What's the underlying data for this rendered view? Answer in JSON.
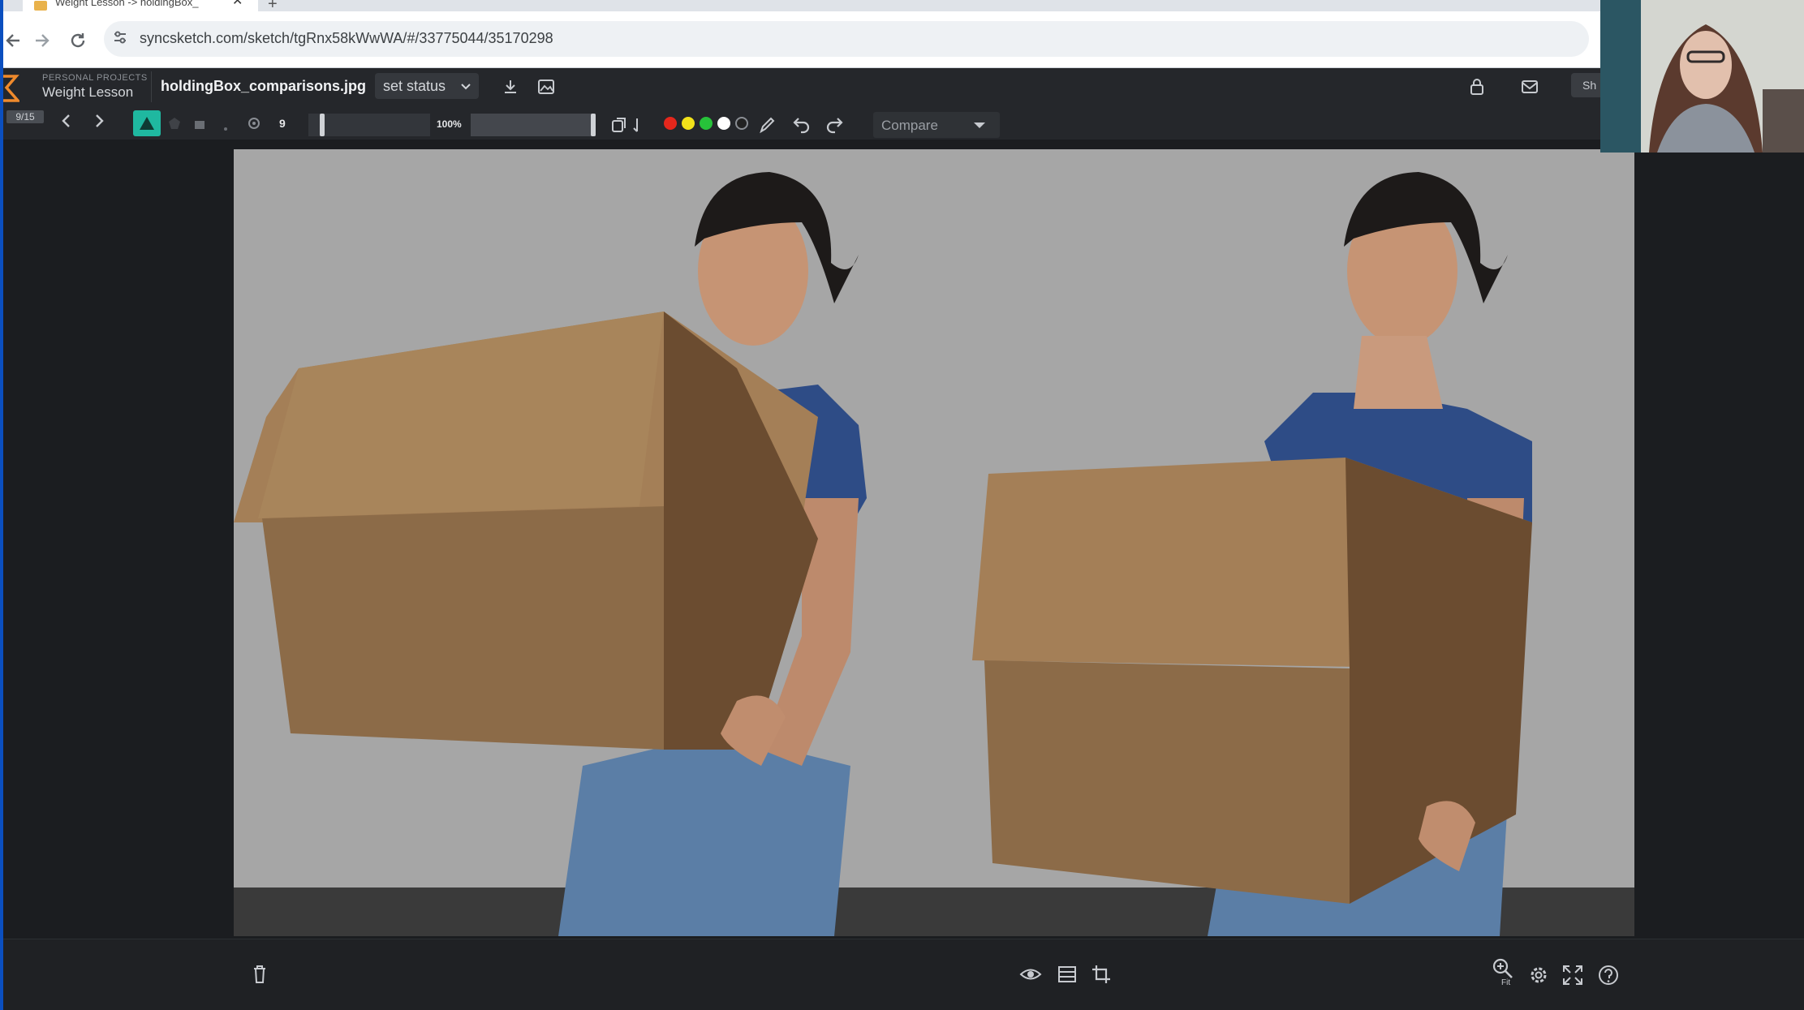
{
  "browser": {
    "tab_title": "Weight Lesson -> holdingBox_",
    "new_tab_label": "+",
    "tab_close": "✕",
    "url": "syncsketch.com/sketch/tgRnx58kWwWA/#/33775044/35170298"
  },
  "app": {
    "project_category": "PERSONAL PROJECTS",
    "project_name": "Weight Lesson",
    "file_name": "holdingBox_comparisons.jpg",
    "status_label": "set status",
    "share_label": "Sh",
    "page_count": "9/15",
    "brush_size": "9",
    "opacity_label": "100%",
    "compare_label": "Compare",
    "brush_size_value": 0.1,
    "opacity_value": 1.0
  },
  "colors": {
    "accent": "#1fb8a0",
    "swatches": [
      "#e5271c",
      "#f2e21a",
      "#27c23a",
      "#ffffff",
      "#222222"
    ]
  },
  "icons": {
    "toolbar": [
      "back-icon",
      "forward-icon",
      "pen-icon",
      "shape-icon",
      "eraser-icon",
      "select-icon",
      "gear-icon",
      "copy-icon",
      "eyedropper-icon",
      "undo-icon",
      "redo-icon"
    ],
    "bottom": [
      "trash-icon",
      "eye-icon",
      "layers-icon",
      "crop-icon",
      "zoom-fit-icon",
      "settings-icon",
      "fullscreen-icon",
      "help-icon"
    ]
  },
  "bottom": {
    "zoom_fit_label": "Fit"
  }
}
